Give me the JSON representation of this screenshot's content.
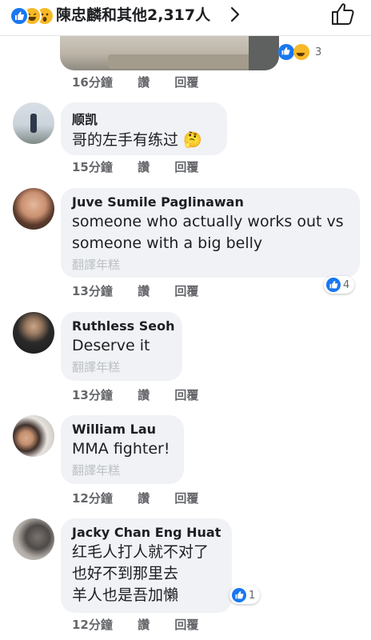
{
  "header": {
    "reactions": [
      "like-icon",
      "haha-icon",
      "wow-icon"
    ],
    "summary": "陳忠麟和其他2,317人"
  },
  "media_post": {
    "reaction_count": "3",
    "time": "16分鐘",
    "like_label": "讚",
    "reply_label": "回覆"
  },
  "comments": [
    {
      "author": "顺凯",
      "text": "哥的左手有练过 🤔",
      "translate": "",
      "time": "15分鐘",
      "like_label": "讚",
      "reply_label": "回覆",
      "reaction_count": ""
    },
    {
      "author": "Juve Sumile Paglinawan",
      "text_lines": [
        "someone who actually works out vs",
        "someone with a big belly"
      ],
      "translate": "翻譯年糕",
      "time": "13分鐘",
      "like_label": "讚",
      "reply_label": "回覆",
      "reaction_count": "4"
    },
    {
      "author": "Ruthless Seoh",
      "text": "Deserve it",
      "translate": "翻譯年糕",
      "time": "13分鐘",
      "like_label": "讚",
      "reply_label": "回覆",
      "reaction_count": ""
    },
    {
      "author": "William Lau",
      "text": "MMA fighter!",
      "translate": "翻譯年糕",
      "time": "12分鐘",
      "like_label": "讚",
      "reply_label": "回覆",
      "reaction_count": ""
    },
    {
      "author": "Jacky Chan Eng Huat",
      "text_lines": [
        "红毛人打人就不对了",
        "也好不到那里去",
        "羊人也是吾加懶"
      ],
      "translate": "",
      "time": "12分鐘",
      "like_label": "讚",
      "reply_label": "回覆",
      "reaction_count": "1"
    }
  ],
  "colors": {
    "like_blue": "#1877f2",
    "bubble_bg": "#f0f2f5",
    "meta_gray": "#65676b"
  }
}
